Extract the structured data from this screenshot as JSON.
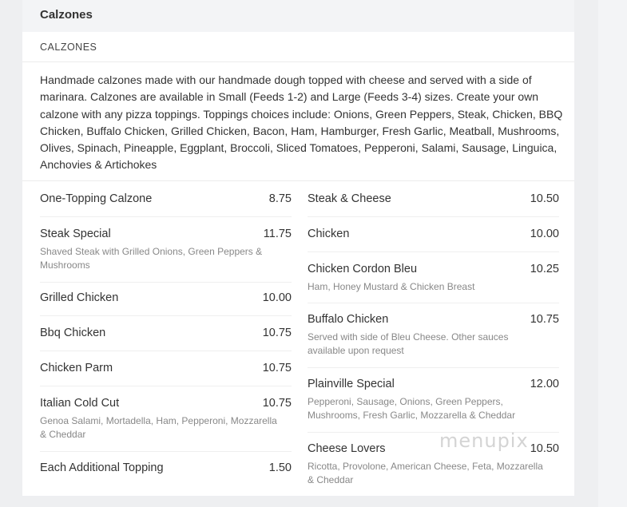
{
  "section": {
    "title": "Calzones"
  },
  "subsection": {
    "title": "CALZONES"
  },
  "description": "Handmade calzones made with our handmade dough topped with cheese and served with a side of marinara. Calzones are available in Small (Feeds 1-2) and Large (Feeds 3-4) sizes. Create your own calzone with any pizza toppings. Toppings choices include: Onions, Green Peppers, Steak, Chicken, BBQ Chicken, Buffalo Chicken, Grilled Chicken, Bacon, Ham, Hamburger, Fresh Garlic, Meatball, Mushrooms, Olives, Spinach, Pineapple, Eggplant, Broccoli, Sliced Tomatoes, Pepperoni, Salami, Sausage, Linguica, Anchovies & Artichokes",
  "left_items": [
    {
      "name": "One-Topping Calzone",
      "price": "8.75",
      "desc": ""
    },
    {
      "name": "Steak Special",
      "price": "11.75",
      "desc": "Shaved Steak with Grilled Onions, Green Peppers & Mushrooms"
    },
    {
      "name": "Grilled Chicken",
      "price": "10.00",
      "desc": ""
    },
    {
      "name": "Bbq Chicken",
      "price": "10.75",
      "desc": ""
    },
    {
      "name": "Chicken Parm",
      "price": "10.75",
      "desc": ""
    },
    {
      "name": "Italian Cold Cut",
      "price": "10.75",
      "desc": "Genoa Salami, Mortadella, Ham, Pepperoni, Mozzarella & Cheddar"
    },
    {
      "name": "Each Additional Topping",
      "price": "1.50",
      "desc": ""
    }
  ],
  "right_items": [
    {
      "name": "Steak & Cheese",
      "price": "10.50",
      "desc": ""
    },
    {
      "name": "Chicken",
      "price": "10.00",
      "desc": ""
    },
    {
      "name": "Chicken Cordon Bleu",
      "price": "10.25",
      "desc": "Ham, Honey Mustard & Chicken Breast"
    },
    {
      "name": "Buffalo Chicken",
      "price": "10.75",
      "desc": "Served with side of Bleu Cheese. Other sauces available upon request"
    },
    {
      "name": "Plainville Special",
      "price": "12.00",
      "desc": "Pepperoni, Sausage, Onions, Green Peppers, Mushrooms, Fresh Garlic, Mozzarella & Cheddar"
    },
    {
      "name": "Cheese Lovers",
      "price": "10.50",
      "desc": "Ricotta, Provolone, American Cheese, Feta, Mozzarella & Cheddar"
    }
  ],
  "watermark": "menupix"
}
